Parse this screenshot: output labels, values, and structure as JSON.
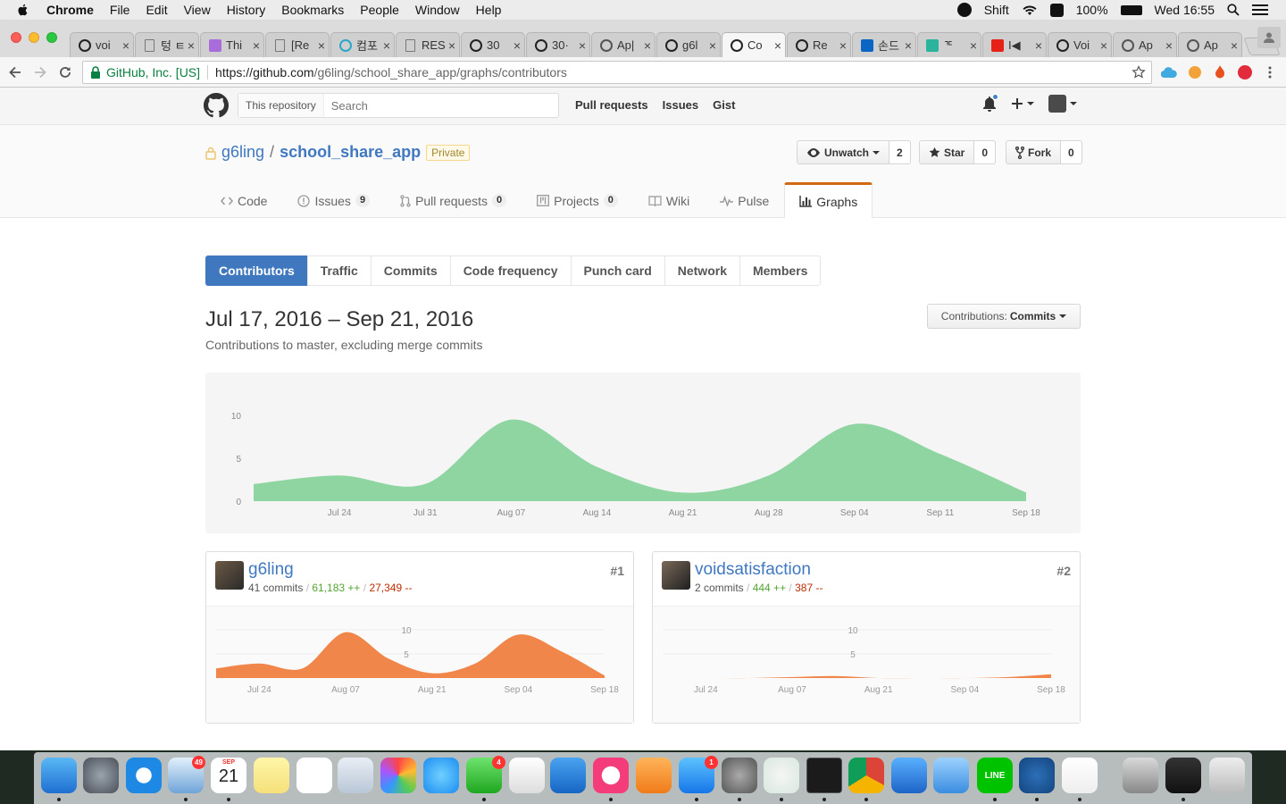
{
  "menubar": {
    "items": [
      "Chrome",
      "File",
      "Edit",
      "View",
      "History",
      "Bookmarks",
      "People",
      "Window",
      "Help"
    ],
    "status": {
      "shift": "Shift",
      "battery": "100%",
      "time": "Wed 16:55"
    }
  },
  "browser": {
    "tabs": [
      {
        "title": "voi",
        "icon": "github-icon"
      },
      {
        "title": "텅 ㅌ",
        "icon": "document-icon"
      },
      {
        "title": "Thi",
        "icon": "graphql-icon"
      },
      {
        "title": "[Re",
        "icon": "document-icon"
      },
      {
        "title": "컴포",
        "icon": "react-icon"
      },
      {
        "title": "RES",
        "icon": "document-icon"
      },
      {
        "title": "30",
        "icon": "github-icon"
      },
      {
        "title": "30·",
        "icon": "github-icon"
      },
      {
        "title": "Ap|",
        "icon": "apollo-icon"
      },
      {
        "title": "g6l",
        "icon": "github-icon"
      },
      {
        "title": "Co",
        "icon": "github-icon",
        "active": true
      },
      {
        "title": "Re",
        "icon": "github-icon"
      },
      {
        "title": "손드",
        "icon": "linkedin-icon"
      },
      {
        "title": "ᄀᄃ",
        "icon": "site-icon"
      },
      {
        "title": "I◀",
        "icon": "youtube-icon"
      },
      {
        "title": "Voi",
        "icon": "github-icon"
      },
      {
        "title": "Ap",
        "icon": "apollo-icon"
      },
      {
        "title": "Ap",
        "icon": "apollo-icon"
      }
    ],
    "security_label": "GitHub, Inc. [US]",
    "url_host": "https://github.com",
    "url_path": "/g6ling/school_share_app/graphs/contributors"
  },
  "github": {
    "scope": "This repository",
    "search_placeholder": "Search",
    "nav": [
      "Pull requests",
      "Issues",
      "Gist"
    ],
    "repo": {
      "owner": "g6ling",
      "name": "school_share_app",
      "visibility": "Private",
      "unwatch_label": "Unwatch",
      "watch_count": "2",
      "star_label": "Star",
      "star_count": "0",
      "fork_label": "Fork",
      "fork_count": "0"
    },
    "reponav": [
      {
        "label": "Code",
        "icon": "code-icon"
      },
      {
        "label": "Issues",
        "count": "9",
        "icon": "issue-icon"
      },
      {
        "label": "Pull requests",
        "count": "0",
        "icon": "pull-request-icon"
      },
      {
        "label": "Projects",
        "count": "0",
        "icon": "project-icon"
      },
      {
        "label": "Wiki",
        "icon": "book-icon"
      },
      {
        "label": "Pulse",
        "icon": "pulse-icon"
      },
      {
        "label": "Graphs",
        "icon": "graph-icon",
        "selected": true
      }
    ],
    "subnav": [
      "Contributors",
      "Traffic",
      "Commits",
      "Code frequency",
      "Punch card",
      "Network",
      "Members"
    ],
    "subnav_selected": "Contributors",
    "range_title": "Jul 17, 2016 – Sep 21, 2016",
    "range_subtitle": "Contributions to master, excluding merge commits",
    "contributions_label": "Contributions:",
    "contributions_value": "Commits"
  },
  "contributors": [
    {
      "name": "g6ling",
      "commits": "41 commits",
      "additions": "61,183 ++",
      "deletions": "27,349 --",
      "rank": "#1"
    },
    {
      "name": "voidsatisfaction",
      "commits": "2 commits",
      "additions": "444 ++",
      "deletions": "387 --",
      "rank": "#2"
    }
  ],
  "colors": {
    "main_area": "#8ed5a2",
    "contrib_area": "#f0864a",
    "link": "#4078c0",
    "selected_tab": "#d26911"
  },
  "chart_data": [
    {
      "type": "area",
      "x": [
        "Jul 17",
        "Jul 24",
        "Jul 31",
        "Aug 07",
        "Aug 14",
        "Aug 21",
        "Aug 28",
        "Sep 04",
        "Sep 11",
        "Sep 18"
      ],
      "values": [
        2,
        3,
        2,
        9.5,
        4,
        1,
        3,
        9,
        5.5,
        1
      ],
      "x_tick_labels": [
        "Jul 24",
        "Jul 31",
        "Aug 07",
        "Aug 14",
        "Aug 21",
        "Aug 28",
        "Sep 04",
        "Sep 11",
        "Sep 18"
      ],
      "y_ticks": [
        0,
        5,
        10
      ],
      "ylim": [
        0,
        10
      ]
    },
    {
      "type": "area",
      "series_owner": "g6ling",
      "x": [
        "Jul 17",
        "Jul 24",
        "Jul 31",
        "Aug 07",
        "Aug 14",
        "Aug 21",
        "Aug 28",
        "Sep 04",
        "Sep 11",
        "Sep 18"
      ],
      "values": [
        2,
        3,
        2,
        9.5,
        4,
        1,
        3,
        9,
        5.5,
        0.5
      ],
      "x_tick_labels": [
        "Jul 24",
        "Aug 07",
        "Aug 21",
        "Sep 04",
        "Sep 18"
      ],
      "y_ticks": [
        5,
        10
      ],
      "ylim": [
        0,
        10
      ]
    },
    {
      "type": "area",
      "series_owner": "voidsatisfaction",
      "x": [
        "Jul 17",
        "Jul 24",
        "Jul 31",
        "Aug 07",
        "Aug 14",
        "Aug 21",
        "Aug 28",
        "Sep 04",
        "Sep 11",
        "Sep 18"
      ],
      "values": [
        0,
        0,
        0,
        0.2,
        0.4,
        0,
        0,
        0,
        0.2,
        0.8
      ],
      "x_tick_labels": [
        "Jul 24",
        "Aug 07",
        "Aug 21",
        "Sep 04",
        "Sep 18"
      ],
      "y_ticks": [
        5,
        10
      ],
      "ylim": [
        0,
        10
      ]
    }
  ],
  "dock": {
    "badges": {
      "mail": "49",
      "calendar_day": "21",
      "calendar_month": "SEP",
      "facetime": "4",
      "appstore": "1"
    }
  }
}
